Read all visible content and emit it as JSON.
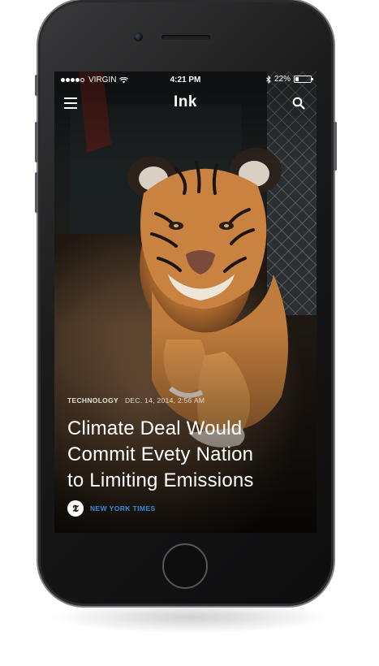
{
  "status_bar": {
    "carrier": "VIRGIN",
    "time": "4:21 PM",
    "battery": "22%",
    "battery_level": 0.22,
    "signal_bars": 4,
    "icons": [
      "signal-dots-icon",
      "wifi-icon",
      "bluetooth-icon",
      "battery-icon"
    ]
  },
  "nav": {
    "title": "Ink",
    "left_icon": "menu-icon",
    "right_icon": "search-icon"
  },
  "article": {
    "category": "TECHNOLOGY",
    "date": "DEC. 14, 2014, 2:56 AM",
    "headline_lines": [
      "Climate Deal Would",
      "Commit Evety Nation",
      "to Limiting Emissions"
    ],
    "source_logo": "𝕿",
    "source": "NEW YORK TIMES",
    "image": "tiger-cub-photo"
  },
  "colors": {
    "source_link": "#2e8fe0",
    "text": "#ffffff"
  }
}
